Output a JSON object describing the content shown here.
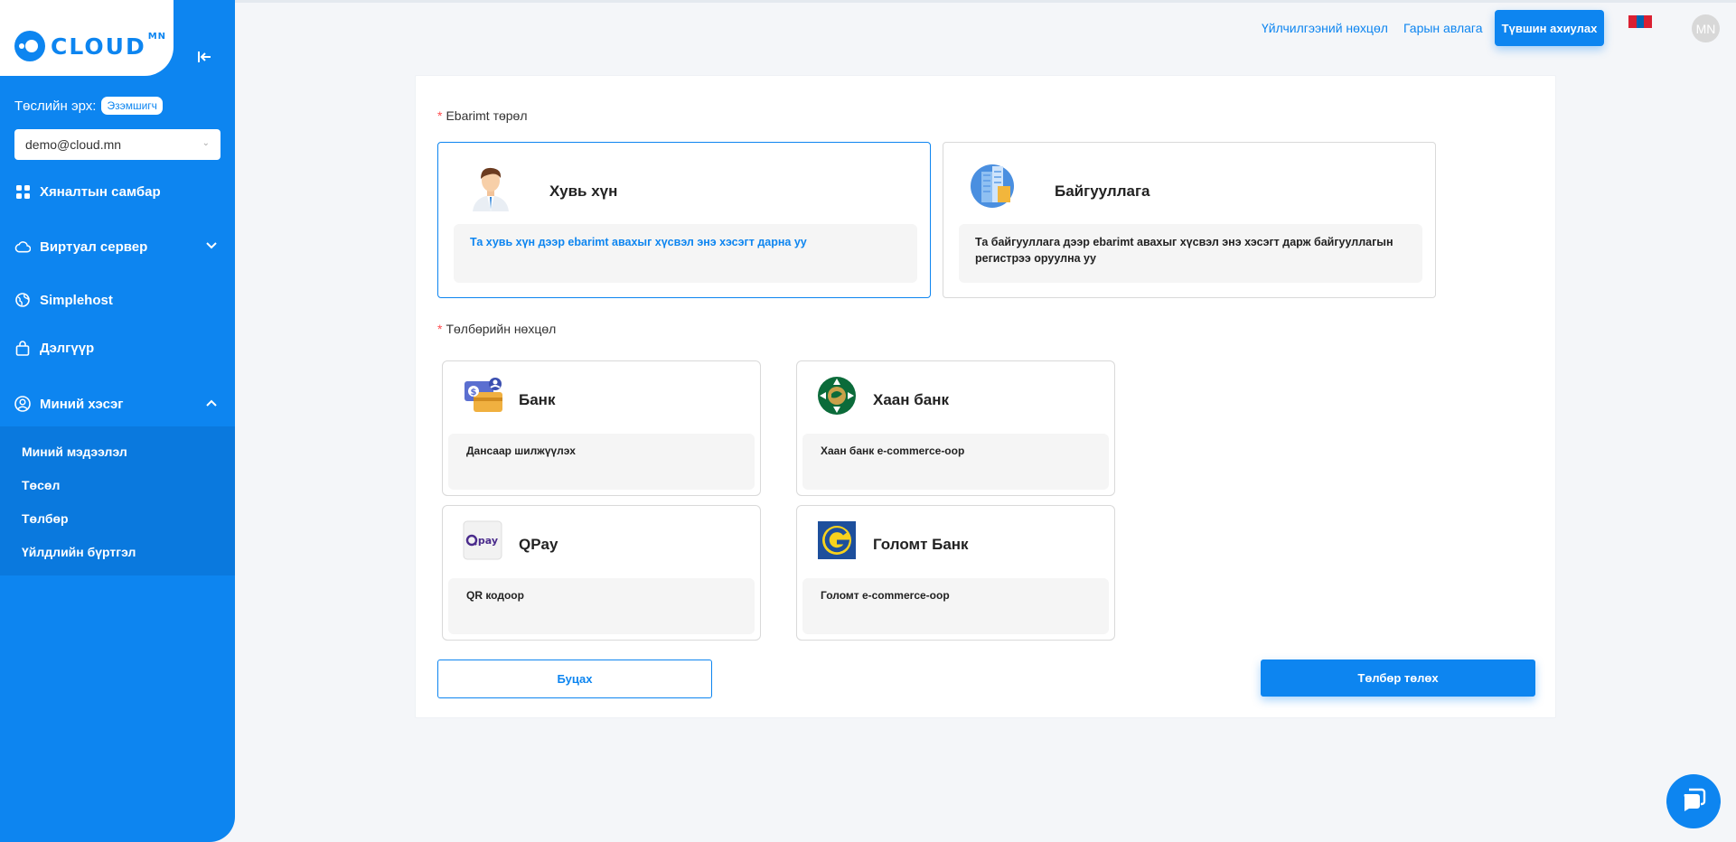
{
  "brand": {
    "name": "CLOUD",
    "sup": "MN"
  },
  "sidebar": {
    "role_label": "Төслийн эрх:",
    "role_badge": "Эзэмшигч",
    "account": "demo@cloud.mn",
    "nav": [
      {
        "label": "Хяналтын самбар",
        "icon": "dashboard-icon"
      },
      {
        "label": "Виртуал сервер",
        "icon": "cloud-icon"
      },
      {
        "label": "Simplehost",
        "icon": "globe-icon"
      },
      {
        "label": "Дэлгүүр",
        "icon": "shopping-bag-icon"
      },
      {
        "label": "Миний хэсэг",
        "icon": "user-circle-icon"
      }
    ],
    "submenu": [
      "Миний мэдээлэл",
      "Төсөл",
      "Төлбөр",
      "Үйлдлийн бүртгэл"
    ]
  },
  "topbar": {
    "terms": "Үйлчилгээний нөхцөл",
    "guide": "Гарын авлага",
    "topup": "Түвшин ахиулах",
    "avatar": "MN"
  },
  "form": {
    "ebarimt_label": "Ebarimt төрөл",
    "types": [
      {
        "title": "Хувь хүн",
        "desc": "Та хувь хүн дээр ebarimt авахыг хүсвэл энэ хэсэгт дарна уу",
        "icon": "person-icon"
      },
      {
        "title": "Байгууллага",
        "desc": "Та байгууллага дээр ebarimt авахыг хүсвэл энэ хэсэгт дарж байгууллагын регистрээ оруулна уу",
        "icon": "building-icon"
      }
    ],
    "payment_label": "Төлбөрийн нөхцөл",
    "payments": [
      {
        "title": "Банк",
        "desc": "Дансаар шилжүүлэх",
        "icon": "bank-transfer-icon"
      },
      {
        "title": "Хаан банк",
        "desc": "Хаан банк e-commerce-оор",
        "icon": "khan-bank-logo-icon"
      },
      {
        "title": "QPay",
        "desc": "QR кодоор",
        "icon": "qpay-logo-icon",
        "logo_text": "pay"
      },
      {
        "title": "Голомт Банк",
        "desc": "Голомт e-commerce-оор",
        "icon": "golomt-logo-icon"
      }
    ],
    "back": "Буцах",
    "pay": "Төлбөр төлөх"
  },
  "colors": {
    "primary": "#0d85f0",
    "required": "#ff4d4f"
  }
}
